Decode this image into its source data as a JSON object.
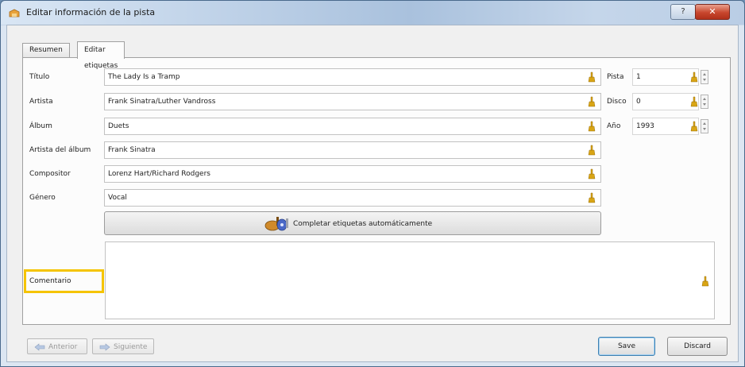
{
  "window": {
    "title": "Editar información de la pista",
    "help_label": "?",
    "close_label": "✕"
  },
  "tabs": [
    {
      "label": "Resumen",
      "selected": false
    },
    {
      "label": "Editar etiquetas",
      "selected": true
    }
  ],
  "fields": {
    "titulo": {
      "label": "Título",
      "value": "The Lady Is a Tramp"
    },
    "artista": {
      "label": "Artista",
      "value": "Frank Sinatra/Luther Vandross"
    },
    "album": {
      "label": "Álbum",
      "value": "Duets"
    },
    "artista_album": {
      "label": "Artista del álbum",
      "value": "Frank Sinatra"
    },
    "compositor": {
      "label": "Compositor",
      "value": "Lorenz Hart/Richard Rodgers"
    },
    "genero": {
      "label": "Género",
      "value": "Vocal"
    },
    "comentario": {
      "label": "Comentario",
      "value": ""
    }
  },
  "side_fields": {
    "pista": {
      "label": "Pista",
      "value": "1"
    },
    "disco": {
      "label": "Disco",
      "value": "0"
    },
    "anio": {
      "label": "Año",
      "value": "1993"
    }
  },
  "autocomplete_button": {
    "label": "Completar etiquetas automáticamente"
  },
  "footer": {
    "previous_label": "Anterior",
    "next_label": "Siguiente",
    "save_label": "Save",
    "discard_label": "Discard"
  },
  "colors": {
    "highlight": "#f5c400",
    "reset_icon": "#d9a514"
  }
}
